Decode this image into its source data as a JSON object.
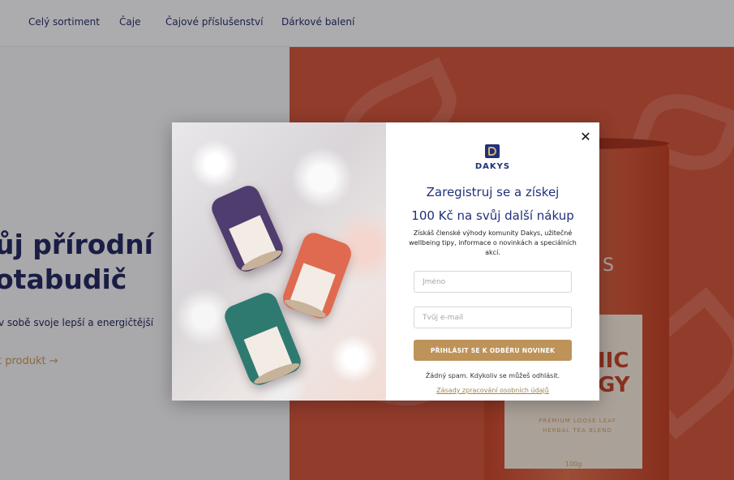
{
  "nav": {
    "items": [
      {
        "label": "Celý sortiment"
      },
      {
        "label": "Čaje"
      },
      {
        "label": "Čajové příslušenství"
      },
      {
        "label": "Dárkové balení"
      }
    ]
  },
  "hero": {
    "title_line1": "ůj přírodní",
    "title_line2": "otabudič",
    "subtitle": "v sobě svoje lepší a energičtější",
    "link": "t produkt →",
    "can_text_large": "S",
    "can_text_name": "IIC\nGY",
    "can_text_small": "PREMIUM LOOSE LEAF HERBAL TEA BLEND",
    "can_text_weight": "100g"
  },
  "modal": {
    "close_label": "✕",
    "logo_text": "DAKYS",
    "headline_line1": "Zaregistruj se a získej",
    "headline_line2": "100 Kč na svůj další nákup",
    "description": "Získáš členské výhody komunity Dakys, užitečné wellbeing tipy, informace o novinkách a speciálních akcí.",
    "name_placeholder": "Jméno",
    "email_placeholder": "Tvůj e-mail",
    "submit_label": "PŘIHLÁSIT SE K ODBĚRU NOVINEK",
    "nospam_text": "Žádný spam. Kdykoliv se můžeš odhlásit.",
    "privacy_link": "Zásady zpracování osobních údajů"
  },
  "colors": {
    "brand_navy": "#20307a",
    "accent_gold": "#bd935a",
    "hero_orange": "#d2573e"
  }
}
